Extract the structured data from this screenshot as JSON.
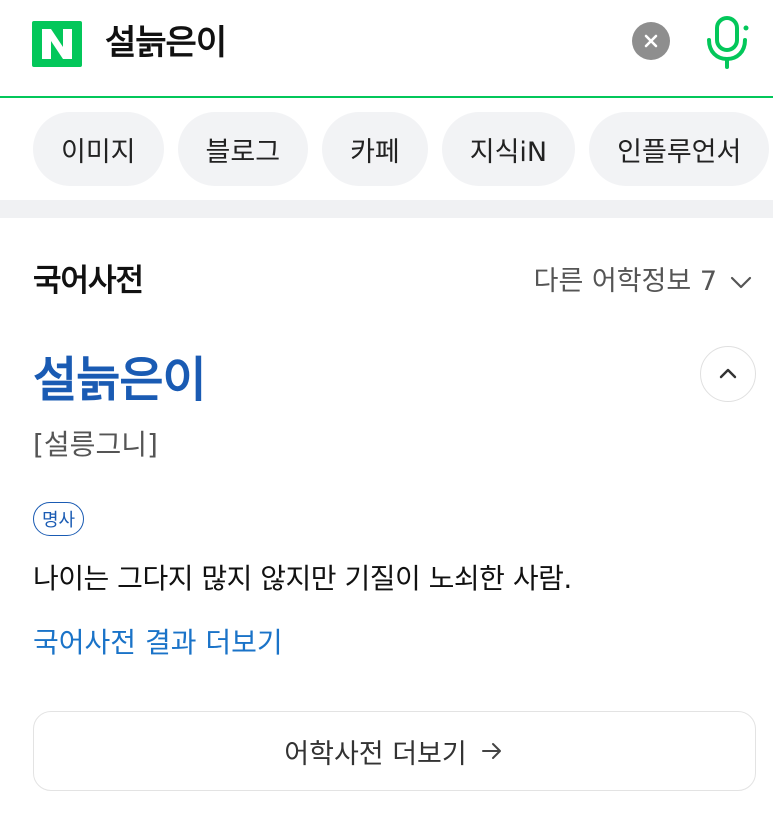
{
  "header": {
    "logo_letter": "N",
    "query": "설늙은이",
    "brand_color": "#03c75a"
  },
  "tabs": [
    {
      "label": "이미지"
    },
    {
      "label": "블로그"
    },
    {
      "label": "카페"
    },
    {
      "label": "지식iN"
    },
    {
      "label": "인플루언서"
    }
  ],
  "dictionary": {
    "section_title": "국어사전",
    "more_info_label": "다른 어학정보 7",
    "entry_word": "설늙은이",
    "pronunciation": "[설릉그니]",
    "part_of_speech": "명사",
    "definition": "나이는 그다지 많지 않지만 기질이 노쇠한 사람.",
    "result_more_link": "국어사전 결과 더보기",
    "dict_more_button": "어학사전 더보기",
    "accent_color": "#1a5bb3"
  },
  "icons": {
    "clear": "close-icon",
    "mic": "microphone-icon",
    "more_info": "chevron-down-icon",
    "collapse": "chevron-up-icon",
    "dict_more": "arrow-right-icon"
  }
}
